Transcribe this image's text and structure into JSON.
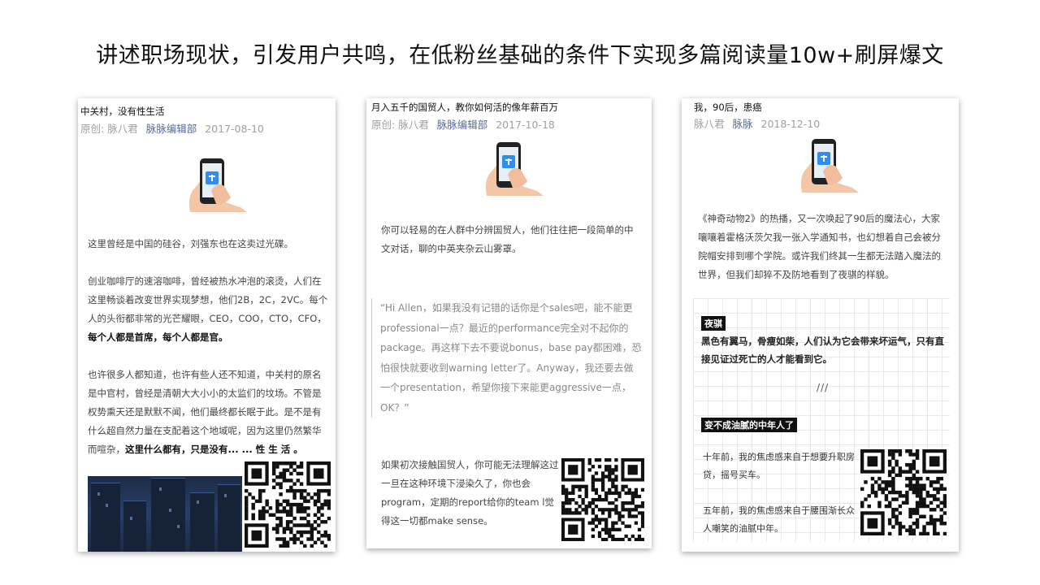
{
  "slide_title": "讲述职场现状，引发用户共鸣，在低粉丝基础的条件下实现多篇阅读量10w+刷屏爆文",
  "cards": [
    {
      "title": "中关村，没有性生活",
      "meta_prefix": "原创:",
      "author": "脉八君",
      "account": "脉脉编辑部",
      "date": "2017-08-10",
      "p1": "这里曾经是中国的硅谷，刘强东也在这卖过光碟。",
      "p2": "创业咖啡厅的速溶咖啡，曾经被热水冲泡的滚烫，人们在这里畅谈着改变世界实现梦想，他们2B，2C，2VC。每个人的头衔都非常的光芒耀眼，CEO，COO，CTO，CFO，",
      "p2_bold": "每个人都是首席，每个人都是官。",
      "p3": "也许很多人都知道，也许有些人还不知道，中关村的原名是中官村，曾经是清朝大大小小的太监们的坟场。不管是权势熏天还是默默不闻，他们最终都长眠于此。是不是有什么超自然力量在支配着这个地域呢，因为这里仍然繁华而喧杂，",
      "p3_bold": "这里什么都有，只是没有... ... 性 生 活 。"
    },
    {
      "title": "月入五千的国贸人，教你如何活的像年薪百万",
      "meta_prefix": "原创:",
      "author": "脉八君",
      "account": "脉脉编辑部",
      "date": "2017-10-18",
      "p1": "你可以轻易的在人群中分辨国贸人，他们往往把一段简单的中文对话，聊的中英夹杂云山雾罩。",
      "quote": "“Hi Allen，如果我没有记错的话你是个sales吧，能不能更professional一点？最近的performance完全对不起你的package。再这样下去不要说bonus，base pay都困难，恐怕很快就要收到warning letter了。Anyway，我还要去做一个presentation，希望你接下来能更aggressive一点，OK？”",
      "p2": "如果初次接触国贸人，你可能无法理解这过一旦在这种环境下浸染久了，你也会program，定期的report给你的team l觉得这一切都make sense。"
    },
    {
      "title": "我，90后，患癌",
      "author": "脉八君",
      "account": "脉脉",
      "date": "2018-12-10",
      "p1": "《神奇动物2》的热播，又一次唤起了90后的魔法心，大家嚷嚷着霍格沃茨欠我一张入学通知书，也幻想着自己会被分院帽安排到哪个学院。或许我们终其一生都无法踏入魔法的世界，但我们却猝不及防地看到了夜骐的样貌。",
      "tag1": "夜骐",
      "g1": "黑色有翼马，骨瘦如柴，人们认为它会带来坏运气，只有直接见证过死亡的人才能看到它。",
      "slashes": "///",
      "tag2": "变不成油腻的中年人了",
      "g2": "十年前，我的焦虑感来自于想要升职房贷，摇号买车。",
      "g3": "五年前，我的焦虑感来自于腰围渐长众人嘲笑的油腻中年。"
    }
  ],
  "colors": {
    "account_link": "#576b95",
    "meta_gray": "#a0a0a0",
    "phone_screen": "#2f8ef0"
  },
  "icons": [
    "phone-in-hand-icon",
    "qr-code-icon"
  ]
}
